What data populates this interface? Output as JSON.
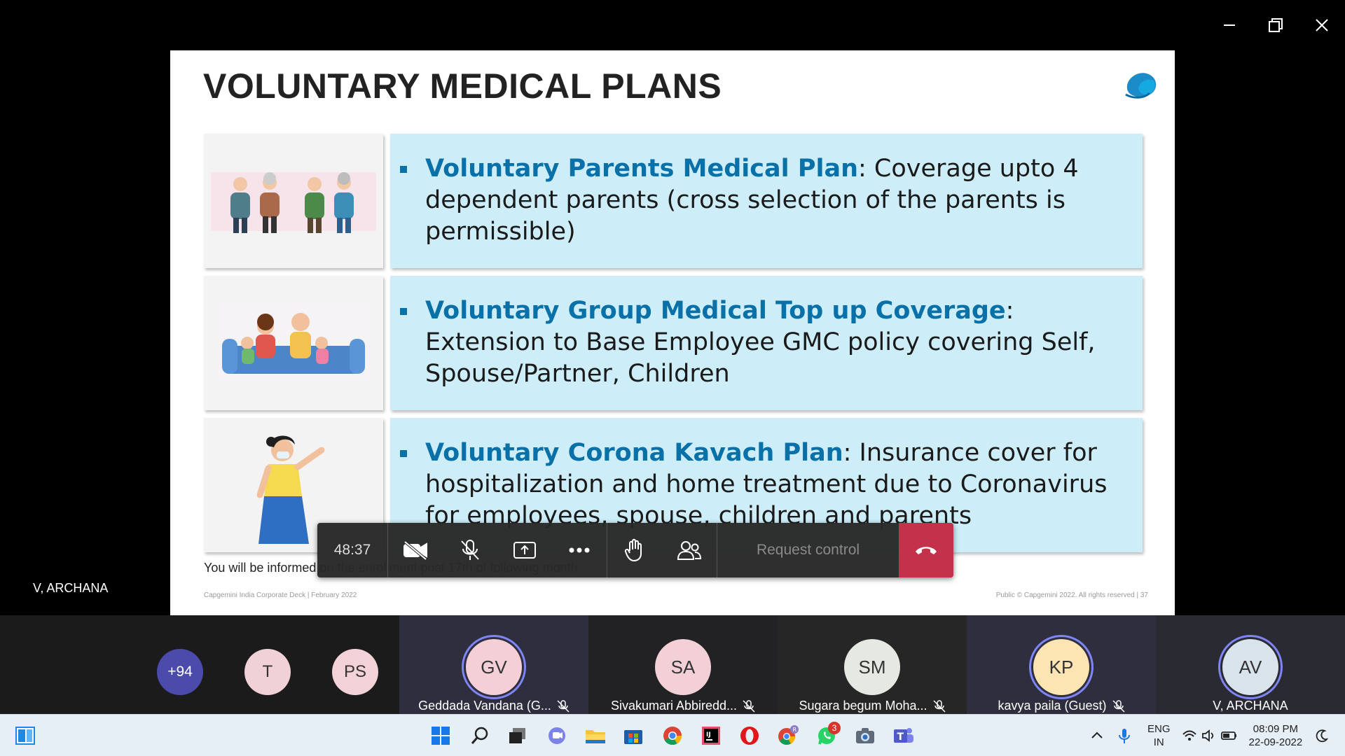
{
  "window": {
    "minimize_label": "Minimize",
    "restore_label": "Restore",
    "close_label": "Close"
  },
  "stage": {
    "presenter_name": "V, ARCHANA"
  },
  "slide": {
    "title": "VOLUNTARY MEDICAL PLANS",
    "rows": [
      {
        "heading": "Voluntary Parents Medical Plan",
        "body": ": Coverage upto 4 dependent parents (cross selection of the parents is permissible)",
        "image": "elderly-couples-illustration"
      },
      {
        "heading": "Voluntary Group Medical Top up Coverage",
        "body": ": Extension to Base Employee GMC policy covering Self, Spouse/Partner, Children",
        "image": "family-on-sofa-illustration"
      },
      {
        "heading": "Voluntary Corona Kavach Plan",
        "body": ": Insurance cover for hospitalization and home treatment due to Coronavirus for employees, spouse, children and parents",
        "image": "woman-with-mask-illustration"
      }
    ],
    "note": "You will be informed on the enrollment post 17th of following month",
    "footer_left": "Capgemini India Corporate Deck | February 2022",
    "footer_right": "Public © Capgemini 2022. All rights reserved |  37"
  },
  "controls": {
    "timer": "48:37",
    "request_control": "Request control",
    "icons": [
      "camera-off-icon",
      "mic-off-icon",
      "share-screen-icon",
      "more-icon",
      "raise-hand-icon",
      "participants-icon",
      "hang-up-icon"
    ]
  },
  "participants": {
    "overflow_count": "+94",
    "small": [
      {
        "initials": "T",
        "color": "#f0d2d6"
      },
      {
        "initials": "PS",
        "color": "#f3d2d7"
      }
    ],
    "tiles": [
      {
        "initials": "GV",
        "name": "Geddada Vandana (G...",
        "color": "#f4cfd6",
        "bg": "#2e2e3f",
        "speaking": true,
        "muted": true
      },
      {
        "initials": "SA",
        "name": "Sivakumari Abbiredd...",
        "color": "#f3d0d6",
        "bg": "#222224",
        "speaking": false,
        "muted": true
      },
      {
        "initials": "SM",
        "name": "Sugara begum Moha...",
        "color": "#e6e9e1",
        "bg": "#262626",
        "speaking": false,
        "muted": true
      },
      {
        "initials": "KP",
        "name": "kavya paila (Guest)",
        "color": "#fde5b3",
        "bg": "#2e2e3f",
        "speaking": true,
        "muted": true
      },
      {
        "initials": "AV",
        "name": "V, ARCHANA",
        "color": "#d9e3ec",
        "bg": "#2a2a33",
        "speaking": true,
        "muted": false
      }
    ],
    "colors": {
      "overflow": "#4b4bab"
    }
  },
  "taskbar": {
    "language_line1": "ENG",
    "language_line2": "IN",
    "time": "08:09 PM",
    "date": "22-09-2022",
    "whatsapp_badge": "3",
    "apps": [
      "start-icon",
      "search-icon",
      "task-view-icon",
      "chat-icon",
      "file-explorer-icon",
      "store-icon",
      "chrome-icon",
      "intellij-icon",
      "opera-icon",
      "chrome-profile-icon",
      "whatsapp-icon",
      "camera-icon",
      "teams-icon"
    ]
  }
}
